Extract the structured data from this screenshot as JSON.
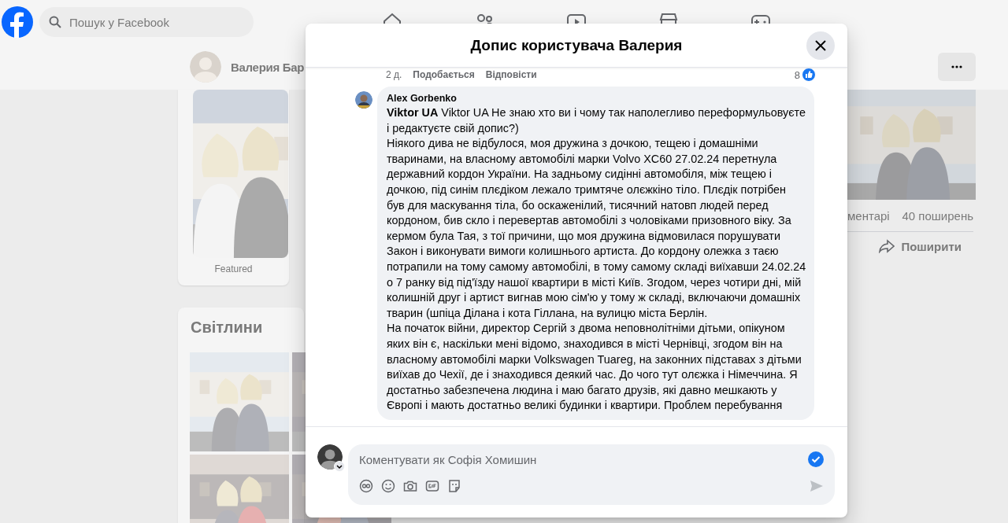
{
  "topbar": {
    "search": {
      "placeholder": "Пошук у Facebook"
    },
    "nav": [
      {
        "kind": "home"
      },
      {
        "kind": "friends"
      },
      {
        "kind": "video"
      },
      {
        "kind": "marketplace"
      },
      {
        "kind": "gaming"
      }
    ]
  },
  "profile": {
    "name": "Валерия Бар"
  },
  "featured": {
    "label": "Featured"
  },
  "photos": {
    "title": "Світлини"
  },
  "post": {
    "stats": [
      "ментарі",
      "40 поширень"
    ],
    "share": "Поширити"
  },
  "dialog": {
    "title": "Допис користувача Валерия",
    "prev_comment": {
      "time": "2 д.",
      "like": "Подобається",
      "reply": "Відповісти",
      "reactions": "8"
    },
    "comment": {
      "author": "Alex Gorbenko",
      "paragraphs": [
        "**Viktor UA** Viktor UA Не знаю хто ви і чому так наполегливо переформульовуєте і редактуєте свій допис?)",
        "Ніякого дива не відбулося, моя дружина з дочкою, тещею і домашніми тваринами, на власному автомобілі марки Volvo XC60 27.02.24 перетнула державний кордон України. На задньому сидінні автомобіля, між тещею і дочкою, під синім плєдіком лежало тримтяче олєжкіно тіло. Плєдік потрібен був для маскування тіла, бо оскаженілий, тисячний натовп людей перед кордоном, бив скло і перевертав автомобілі з чоловіками призовного віку. За кермом була Тая, з тої причини, що моя дружина відмовилася порушувати Закон і виконувати вимоги колишнього артиста. До кордону олежка з таєю потрапили на тому самому автомобілі, в тому самому складі виїхавши 24.02.24 о 7 ранку від під'їзду нашої квартири в місті Київ. Згодом, через чотири дні, мій колишній друг і артист вигнав мою сім'ю у тому ж складі, включаючи домашніх тварин (шпіца Ділана і кота Гіллана, на вулицю міста Берлін.",
        "На початок війни, директор Сергій з двома неповнолітніми дітьми, опікуном яких він є, наскільки мені відомо, знаходився в місті Чернівці, згодом він на власному автомобілі марки Volkswagen Tuareg, на законних підставах з дітьми виїхав до Чехії, де і знаходився деякий час. До чого тут олєжка і Німеччина. Я достатньо забезпечена людина і маю багато друзів, які давно мешкають у Європі і мають достатньо великі будинки і квартири. Проблем перебування"
      ]
    },
    "composer": {
      "placeholder": "Коментувати як Софія Хомишин",
      "tools": [
        {
          "kind": "avatar"
        },
        {
          "kind": "emoji"
        },
        {
          "kind": "camera"
        },
        {
          "kind": "gif"
        },
        {
          "kind": "sticker"
        }
      ],
      "send_disabled": true
    }
  }
}
